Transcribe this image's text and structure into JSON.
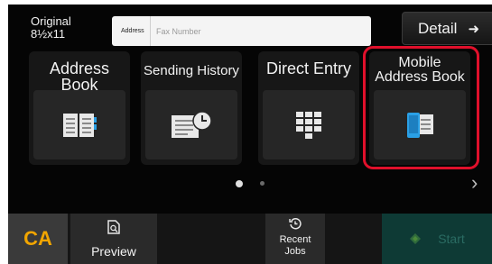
{
  "header": {
    "original_label": "Original",
    "original_size": "8½x11",
    "address_label": "Address",
    "fax_placeholder": "Fax Number",
    "detail_label": "Detail"
  },
  "destinations": [
    {
      "label": "Address Book",
      "icon": "address-book-icon"
    },
    {
      "label": "Sending History",
      "icon": "sending-history-icon"
    },
    {
      "label": "Direct Entry",
      "icon": "keypad-icon"
    },
    {
      "label": "Mobile Address Book",
      "label_line1": "Mobile",
      "label_line2": "Address Book",
      "icon": "mobile-address-book-icon",
      "highlighted": true
    }
  ],
  "pagination": {
    "pages": 2,
    "current": 1
  },
  "bottom_bar": {
    "ca_label": "CA",
    "preview_label": "Preview",
    "recent_jobs_line1": "Recent",
    "recent_jobs_line2": "Jobs",
    "start_label": "Start"
  },
  "colors": {
    "highlight": "#e0102b",
    "ca": "#f1a500",
    "icon_blue": "#2aa0e6"
  }
}
